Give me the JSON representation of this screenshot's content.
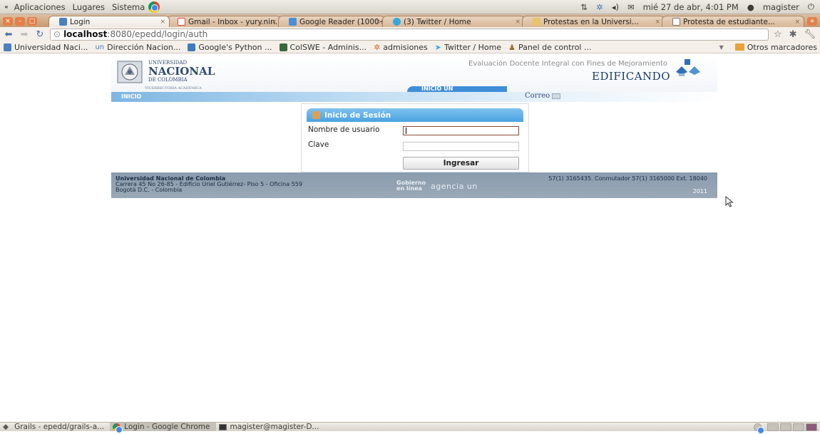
{
  "top_panel": {
    "menus": [
      "Aplicaciones",
      "Lugares",
      "Sistema"
    ],
    "datetime": "mié 27 de abr, 4:01 PM",
    "user": "magister"
  },
  "tabs": [
    {
      "title": "Login",
      "active": true
    },
    {
      "title": "Gmail - Inbox - yury.nin...",
      "active": false
    },
    {
      "title": "Google Reader (1000+)",
      "active": false
    },
    {
      "title": "(3) Twitter / Home",
      "active": false
    },
    {
      "title": "Protestas en la Universi...",
      "active": false
    },
    {
      "title": "Protesta de estudiante...",
      "active": false
    }
  ],
  "url": {
    "host": "localhost",
    "path": ":8080/epedd/login/auth"
  },
  "bookmarks": [
    "Universidad Naci...",
    "Dirección Nacion...",
    "Google's Python ...",
    "ColSWE - Adminis...",
    "admisiones",
    "Twitter / Home",
    "Panel de control ..."
  ],
  "other_bookmarks": "Otros marcadores",
  "page": {
    "logo": {
      "line1": "UNIVERSIDAD",
      "line2": "NACIONAL",
      "line3": "DE COLOMBIA",
      "line4": "VICERRECTORÍA ACADÉMICA"
    },
    "system_subtitle": "Evaluación Docente Integral con Fines de Mejoramiento",
    "system_title": "EDIFICANDO",
    "nav_inicio": "INICIO",
    "nav_inicio_un": "INICIO UN",
    "correo": "Correo",
    "login": {
      "title": "Inicio de Sesión",
      "username_label": "Nombre de usuario",
      "username_value": "",
      "password_label": "Clave",
      "submit_label": "Ingresar"
    },
    "footer": {
      "org": "Universidad Nacional de Colombia",
      "address1": "Carrera 45 No 26-85 - Edificio Uriel Gutiérrez- Piso 5 - Oficina 559",
      "address2": "Bogotá D.C. - Colombia",
      "gobierno": "Gobierno en línea",
      "agencia": "agencia un",
      "phones": "57(1) 3165435. Conmutador 57(1) 3165000 Ext. 18040",
      "year": "2011"
    }
  },
  "taskbar": [
    {
      "title": "Grails - epedd/grails-a...",
      "active": false
    },
    {
      "title": "Login - Google Chrome",
      "active": true
    },
    {
      "title": "magister@magister-D...",
      "active": false
    }
  ]
}
